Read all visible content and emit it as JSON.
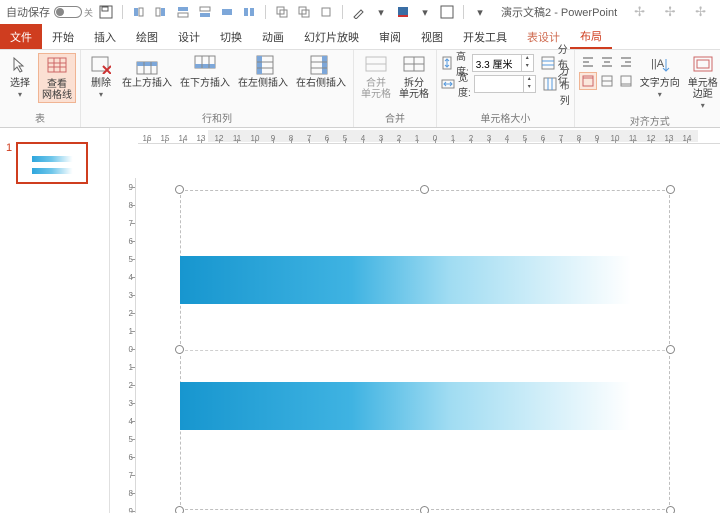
{
  "title": {
    "autosave": "自动保存",
    "doc": "演示文稿2 - PowerPoint"
  },
  "tabs": {
    "file": "文件",
    "home": "开始",
    "insert": "插入",
    "draw": "绘图",
    "design": "设计",
    "transitions": "切换",
    "anim": "动画",
    "slideshow": "幻灯片放映",
    "review": "审阅",
    "view": "视图",
    "dev": "开发工具",
    "tbldesign": "表设计",
    "layout": "布局"
  },
  "ribbon": {
    "select": "选择",
    "gridlines": "查看\n网格线",
    "delete": "删除",
    "ins_above": "在上方插入",
    "ins_below": "在下方插入",
    "ins_left": "在左侧插入",
    "ins_right": "在右侧插入",
    "merge": "合并\n单元格",
    "split": "拆分\n单元格",
    "height": "高度:",
    "height_val": "3.3 厘米",
    "width": "宽度:",
    "width_val": "",
    "dist_rows": "分布行",
    "dist_cols": "分布列",
    "text_dir": "文字方向",
    "cell_margins": "单元格\n边距",
    "grp_table": "表",
    "grp_rowcol": "行和列",
    "grp_merge": "合并",
    "grp_size": "单元格大小",
    "grp_align": "对齐方式"
  },
  "ruler_h": [
    "16",
    "15",
    "14",
    "13",
    "12",
    "11",
    "10",
    "9",
    "8",
    "7",
    "6",
    "5",
    "4",
    "3",
    "2",
    "1",
    "0",
    "1",
    "2",
    "3",
    "4",
    "5",
    "6",
    "7",
    "8",
    "9",
    "10",
    "11",
    "12",
    "13",
    "14"
  ],
  "ruler_v": [
    "9",
    "8",
    "7",
    "6",
    "5",
    "4",
    "3",
    "2",
    "1",
    "0",
    "1",
    "2",
    "3",
    "4",
    "5",
    "6",
    "7",
    "8",
    "9"
  ],
  "thumb": {
    "num": "1"
  }
}
